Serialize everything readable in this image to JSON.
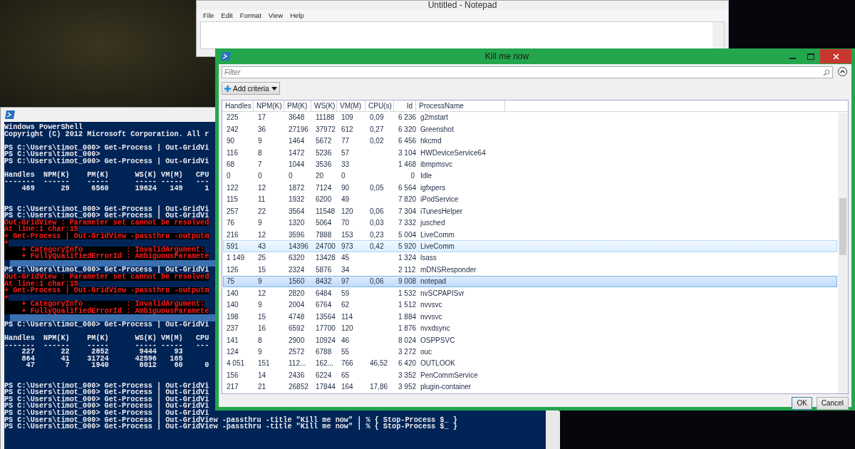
{
  "notepad": {
    "title": "Untitled - Notepad",
    "menu": [
      "File",
      "Edit",
      "Format",
      "View",
      "Help"
    ]
  },
  "powershell": {
    "lines": [
      {
        "kind": "output",
        "text": "Windows PowerShell"
      },
      {
        "kind": "output",
        "text": "Copyright (C) 2012 Microsoft Corporation. All r"
      },
      {
        "kind": "blank"
      },
      {
        "kind": "output",
        "text": "PS C:\\Users\\timot_000> Get-Process | Out-GridVi"
      },
      {
        "kind": "output",
        "text": "PS C:\\Users\\timot_000>"
      },
      {
        "kind": "output",
        "text": "PS C:\\Users\\timot_000> Get-Process | Out-GridVi"
      },
      {
        "kind": "blank"
      },
      {
        "kind": "output",
        "text": "Handles  NPM(K)    PM(K)      WS(K) VM(M)   CPU"
      },
      {
        "kind": "output",
        "text": "-------  ------    -----      ----- -----   ---"
      },
      {
        "kind": "output",
        "text": "    469      29     6560      19624   149     1"
      },
      {
        "kind": "blank"
      },
      {
        "kind": "blank"
      },
      {
        "kind": "output",
        "text": "PS C:\\Users\\timot_000> Get-Process | Out-GridVi"
      },
      {
        "kind": "output",
        "text": "PS C:\\Users\\timot_000> Get-Process | Out-GridVi"
      },
      {
        "kind": "error",
        "text": "Out-GridView : Parameter set cannot be resolved"
      },
      {
        "kind": "error",
        "text": "At line:1 char:15"
      },
      {
        "kind": "error",
        "text": "+ Get-Process | Out-GridView -passthru -outputm"
      },
      {
        "kind": "error",
        "text": "+"
      },
      {
        "kind": "error",
        "text": "    + CategoryInfo          : InvalidArgument:"
      },
      {
        "kind": "error",
        "text": "    + FullyQualifiedErrorId : AmbiguousParamete"
      },
      {
        "kind": "marked"
      },
      {
        "kind": "output",
        "text": "PS C:\\Users\\timot_000> Get-Process | Out-GridVi"
      },
      {
        "kind": "error",
        "text": "Out-GridView : Parameter set cannot be resolved"
      },
      {
        "kind": "error",
        "text": "At line:1 char:15"
      },
      {
        "kind": "error",
        "text": "+ Get-Process | Out-GridView -passthru -outputm"
      },
      {
        "kind": "error",
        "text": "+"
      },
      {
        "kind": "error",
        "text": "    + CategoryInfo          : InvalidArgument:"
      },
      {
        "kind": "error",
        "text": "    + FullyQualifiedErrorId : AmbiguousParamete"
      },
      {
        "kind": "marked"
      },
      {
        "kind": "output",
        "text": "PS C:\\Users\\timot_000> Get-Process | Out-GridVi"
      },
      {
        "kind": "blank"
      },
      {
        "kind": "output",
        "text": "Handles  NPM(K)    PM(K)      WS(K) VM(M)   CPU"
      },
      {
        "kind": "output",
        "text": "-------  ------    -----      ----- -----   ---"
      },
      {
        "kind": "output",
        "text": "    227      22     2852       9444    93"
      },
      {
        "kind": "output",
        "text": "    864      41    31724      42596   165"
      },
      {
        "kind": "output",
        "text": "     47       7     1940       8012    60     0"
      },
      {
        "kind": "blank"
      },
      {
        "kind": "blank"
      },
      {
        "kind": "output",
        "text": "PS C:\\Users\\timot_000> Get-Process | Out-GridVi"
      },
      {
        "kind": "output",
        "text": "PS C:\\Users\\timot_000> Get-Process | Out-GridVi"
      },
      {
        "kind": "output",
        "text": "PS C:\\Users\\timot_000> Get-Process | Out-GridVi"
      },
      {
        "kind": "output",
        "text": "PS C:\\Users\\timot_000> Get-Process | Out-GridVi"
      },
      {
        "kind": "output",
        "text": "PS C:\\Users\\timot_000> Get-Process | Out-GridVi"
      },
      {
        "kind": "output",
        "text": "PS C:\\Users\\timot_000> Get-Process | Out-GridView -passthru -title \"Kill me now\" | % { Stop-Process $_ }"
      },
      {
        "kind": "output",
        "text": "PS C:\\Users\\timot_000> Get-Process | Out-GridView -passthru -title \"Kill me now\" | % { Stop-Process $_ }"
      }
    ]
  },
  "grid_window": {
    "title": "Kill me now",
    "filter": {
      "placeholder": "Filter"
    },
    "add_criteria": "Add criteria",
    "table": {
      "columns": [
        "Handles",
        "NPM(K)",
        "PM(K)",
        "WS(K)",
        "VM(M)",
        "CPU(s)",
        "Id",
        "ProcessName"
      ],
      "rows": [
        {
          "cells": [
            "225",
            "17",
            "3648",
            "11188",
            "109",
            "0,09",
            "6 236",
            "g2mstart"
          ],
          "selected": false,
          "hovered": false
        },
        {
          "cells": [
            "242",
            "36",
            "27196",
            "37972",
            "612",
            "0,27",
            "6 320",
            "Greenshot"
          ],
          "selected": false,
          "hovered": false
        },
        {
          "cells": [
            "90",
            "9",
            "1464",
            "5672",
            "77",
            "0,02",
            "6 456",
            "hkcmd"
          ],
          "selected": false,
          "hovered": false
        },
        {
          "cells": [
            "116",
            "8",
            "1472",
            "5236",
            "57",
            null,
            "3 104",
            "HWDeviceService64"
          ],
          "selected": false,
          "hovered": false
        },
        {
          "cells": [
            "68",
            "7",
            "1044",
            "3536",
            "33",
            null,
            "1 468",
            "ibmpmsvc"
          ],
          "selected": false,
          "hovered": false
        },
        {
          "cells": [
            "0",
            "0",
            "0",
            "20",
            "0",
            null,
            "0",
            "Idle"
          ],
          "selected": false,
          "hovered": false
        },
        {
          "cells": [
            "122",
            "12",
            "1872",
            "7124",
            "90",
            "0,05",
            "6 564",
            "igfxpers"
          ],
          "selected": false,
          "hovered": false
        },
        {
          "cells": [
            "115",
            "11",
            "1932",
            "6200",
            "49",
            null,
            "7 820",
            "iPodService"
          ],
          "selected": false,
          "hovered": false
        },
        {
          "cells": [
            "257",
            "22",
            "3564",
            "11548",
            "120",
            "0,06",
            "7 304",
            "iTunesHelper"
          ],
          "selected": false,
          "hovered": false
        },
        {
          "cells": [
            "76",
            "9",
            "1320",
            "5064",
            "70",
            "0,03",
            "7 332",
            "jusched"
          ],
          "selected": false,
          "hovered": false
        },
        {
          "cells": [
            "216",
            "12",
            "3596",
            "7888",
            "153",
            "0,23",
            "5 004",
            "LiveComm"
          ],
          "selected": false,
          "hovered": false
        },
        {
          "cells": [
            "591",
            "43",
            "14396",
            "24700",
            "973",
            "0,42",
            "5 920",
            "LiveComm"
          ],
          "selected": false,
          "hovered": true
        },
        {
          "cells": [
            "1 149",
            "25",
            "6320",
            "13428",
            "45",
            null,
            "1 324",
            "lsass"
          ],
          "selected": false,
          "hovered": false
        },
        {
          "cells": [
            "126",
            "15",
            "2324",
            "5876",
            "34",
            null,
            "2 112",
            "mDNSResponder"
          ],
          "selected": false,
          "hovered": false
        },
        {
          "cells": [
            "75",
            "9",
            "1560",
            "8432",
            "97",
            "0,06",
            "9 008",
            "notepad"
          ],
          "selected": true,
          "hovered": false
        },
        {
          "cells": [
            "140",
            "12",
            "2820",
            "6484",
            "59",
            null,
            "1 532",
            "nvSCPAPISvr"
          ],
          "selected": false,
          "hovered": false
        },
        {
          "cells": [
            "140",
            "9",
            "2004",
            "6764",
            "62",
            null,
            "1 512",
            "nvvsvc"
          ],
          "selected": false,
          "hovered": false
        },
        {
          "cells": [
            "198",
            "15",
            "4748",
            "13564",
            "114",
            null,
            "1 884",
            "nvvsvc"
          ],
          "selected": false,
          "hovered": false
        },
        {
          "cells": [
            "237",
            "16",
            "6592",
            "17700",
            "120",
            null,
            "1 876",
            "nvxdsync"
          ],
          "selected": false,
          "hovered": false
        },
        {
          "cells": [
            "141",
            "8",
            "2900",
            "10924",
            "46",
            null,
            "8 024",
            "OSPPSVC"
          ],
          "selected": false,
          "hovered": false
        },
        {
          "cells": [
            "124",
            "9",
            "2572",
            "6788",
            "55",
            null,
            "3 272",
            "ouc"
          ],
          "selected": false,
          "hovered": false
        },
        {
          "cells": [
            "4 051",
            "151",
            "112...",
            "162...",
            "766",
            "46,52",
            "6 420",
            "OUTLOOK"
          ],
          "selected": false,
          "hovered": false
        },
        {
          "cells": [
            "156",
            "14",
            "2436",
            "6224",
            "65",
            null,
            "3 352",
            "PenCommService"
          ],
          "selected": false,
          "hovered": false
        },
        {
          "cells": [
            "217",
            "21",
            "26852",
            "17844",
            "164",
            "17,86",
            "3 952",
            "plugin-container"
          ],
          "selected": false,
          "hovered": false
        }
      ]
    },
    "buttons": [
      "OK",
      "Cancel"
    ]
  }
}
